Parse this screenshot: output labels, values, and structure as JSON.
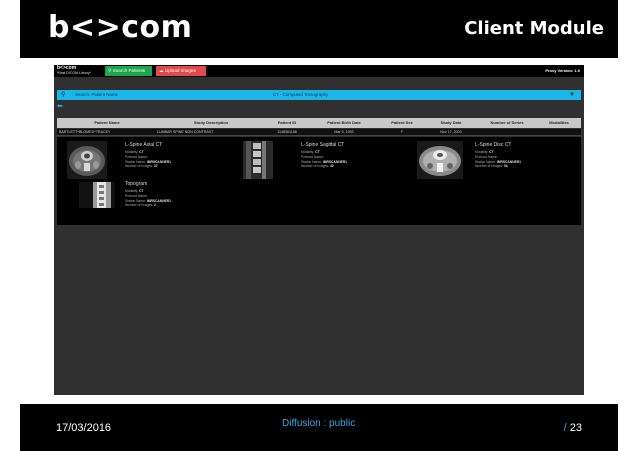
{
  "slide": {
    "logo": "b<>com",
    "title": "Client Module",
    "footer": {
      "date": "17/03/2016",
      "diffusion": "Diffusion : public",
      "page": "23",
      "slash": "/"
    }
  },
  "app": {
    "logo": "b<>com",
    "logo_sub": "*Best DICOM Library*",
    "search_patients": "Search Patients",
    "upload_images": "Upload Images",
    "proxy_version": "Proxy Version: 1.0",
    "search": {
      "placeholder": "Search: Patient Name",
      "modality": "CT - Computed Tomography"
    },
    "table": {
      "headers": [
        "Patient Name",
        "Study Description",
        "Patient ID",
        "Patient Birth Date",
        "Patient Sex",
        "Study Date",
        "Number of Series",
        "Modalities"
      ],
      "row": [
        "BARTLETT^BLOMED^TRACEY",
        "LUMBAR SPINE NON CONTRAST",
        "1148361168",
        "Mar 5, 1953",
        "F",
        "Nov 17, 2003",
        "",
        ""
      ]
    },
    "series": [
      {
        "title": "L-Spine Axial CT",
        "modality": "CT",
        "protocol": "",
        "station": "IMRSCANNER1",
        "images": "37"
      },
      {
        "title": "L-Spine Sagittal CT",
        "modality": "CT",
        "protocol": "",
        "station": "IMRSCANNER1",
        "images": "40"
      },
      {
        "title": "L-Spine Disc CT",
        "modality": "CT",
        "protocol": "",
        "station": "IMRSCANNER1",
        "images": "54"
      },
      {
        "title": "Topogram",
        "modality": "CT",
        "protocol": "",
        "station": "IMRSCANNER1",
        "images": "2"
      }
    ],
    "meta_labels": {
      "modality": "Modality:",
      "protocol": "Protocol Name:",
      "station": "Station Name:",
      "images": "Number of Images:"
    }
  }
}
